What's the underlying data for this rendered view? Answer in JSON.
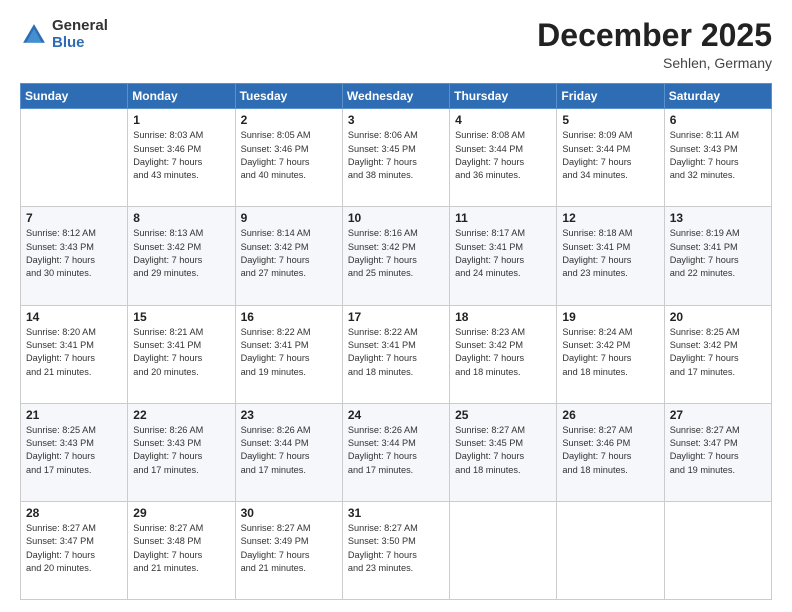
{
  "logo": {
    "general": "General",
    "blue": "Blue"
  },
  "header": {
    "month": "December 2025",
    "location": "Sehlen, Germany"
  },
  "days_of_week": [
    "Sunday",
    "Monday",
    "Tuesday",
    "Wednesday",
    "Thursday",
    "Friday",
    "Saturday"
  ],
  "weeks": [
    [
      {
        "day": "",
        "info": ""
      },
      {
        "day": "1",
        "info": "Sunrise: 8:03 AM\nSunset: 3:46 PM\nDaylight: 7 hours\nand 43 minutes."
      },
      {
        "day": "2",
        "info": "Sunrise: 8:05 AM\nSunset: 3:46 PM\nDaylight: 7 hours\nand 40 minutes."
      },
      {
        "day": "3",
        "info": "Sunrise: 8:06 AM\nSunset: 3:45 PM\nDaylight: 7 hours\nand 38 minutes."
      },
      {
        "day": "4",
        "info": "Sunrise: 8:08 AM\nSunset: 3:44 PM\nDaylight: 7 hours\nand 36 minutes."
      },
      {
        "day": "5",
        "info": "Sunrise: 8:09 AM\nSunset: 3:44 PM\nDaylight: 7 hours\nand 34 minutes."
      },
      {
        "day": "6",
        "info": "Sunrise: 8:11 AM\nSunset: 3:43 PM\nDaylight: 7 hours\nand 32 minutes."
      }
    ],
    [
      {
        "day": "7",
        "info": "Sunrise: 8:12 AM\nSunset: 3:43 PM\nDaylight: 7 hours\nand 30 minutes."
      },
      {
        "day": "8",
        "info": "Sunrise: 8:13 AM\nSunset: 3:42 PM\nDaylight: 7 hours\nand 29 minutes."
      },
      {
        "day": "9",
        "info": "Sunrise: 8:14 AM\nSunset: 3:42 PM\nDaylight: 7 hours\nand 27 minutes."
      },
      {
        "day": "10",
        "info": "Sunrise: 8:16 AM\nSunset: 3:42 PM\nDaylight: 7 hours\nand 25 minutes."
      },
      {
        "day": "11",
        "info": "Sunrise: 8:17 AM\nSunset: 3:41 PM\nDaylight: 7 hours\nand 24 minutes."
      },
      {
        "day": "12",
        "info": "Sunrise: 8:18 AM\nSunset: 3:41 PM\nDaylight: 7 hours\nand 23 minutes."
      },
      {
        "day": "13",
        "info": "Sunrise: 8:19 AM\nSunset: 3:41 PM\nDaylight: 7 hours\nand 22 minutes."
      }
    ],
    [
      {
        "day": "14",
        "info": "Sunrise: 8:20 AM\nSunset: 3:41 PM\nDaylight: 7 hours\nand 21 minutes."
      },
      {
        "day": "15",
        "info": "Sunrise: 8:21 AM\nSunset: 3:41 PM\nDaylight: 7 hours\nand 20 minutes."
      },
      {
        "day": "16",
        "info": "Sunrise: 8:22 AM\nSunset: 3:41 PM\nDaylight: 7 hours\nand 19 minutes."
      },
      {
        "day": "17",
        "info": "Sunrise: 8:22 AM\nSunset: 3:41 PM\nDaylight: 7 hours\nand 18 minutes."
      },
      {
        "day": "18",
        "info": "Sunrise: 8:23 AM\nSunset: 3:42 PM\nDaylight: 7 hours\nand 18 minutes."
      },
      {
        "day": "19",
        "info": "Sunrise: 8:24 AM\nSunset: 3:42 PM\nDaylight: 7 hours\nand 18 minutes."
      },
      {
        "day": "20",
        "info": "Sunrise: 8:25 AM\nSunset: 3:42 PM\nDaylight: 7 hours\nand 17 minutes."
      }
    ],
    [
      {
        "day": "21",
        "info": "Sunrise: 8:25 AM\nSunset: 3:43 PM\nDaylight: 7 hours\nand 17 minutes."
      },
      {
        "day": "22",
        "info": "Sunrise: 8:26 AM\nSunset: 3:43 PM\nDaylight: 7 hours\nand 17 minutes."
      },
      {
        "day": "23",
        "info": "Sunrise: 8:26 AM\nSunset: 3:44 PM\nDaylight: 7 hours\nand 17 minutes."
      },
      {
        "day": "24",
        "info": "Sunrise: 8:26 AM\nSunset: 3:44 PM\nDaylight: 7 hours\nand 17 minutes."
      },
      {
        "day": "25",
        "info": "Sunrise: 8:27 AM\nSunset: 3:45 PM\nDaylight: 7 hours\nand 18 minutes."
      },
      {
        "day": "26",
        "info": "Sunrise: 8:27 AM\nSunset: 3:46 PM\nDaylight: 7 hours\nand 18 minutes."
      },
      {
        "day": "27",
        "info": "Sunrise: 8:27 AM\nSunset: 3:47 PM\nDaylight: 7 hours\nand 19 minutes."
      }
    ],
    [
      {
        "day": "28",
        "info": "Sunrise: 8:27 AM\nSunset: 3:47 PM\nDaylight: 7 hours\nand 20 minutes."
      },
      {
        "day": "29",
        "info": "Sunrise: 8:27 AM\nSunset: 3:48 PM\nDaylight: 7 hours\nand 21 minutes."
      },
      {
        "day": "30",
        "info": "Sunrise: 8:27 AM\nSunset: 3:49 PM\nDaylight: 7 hours\nand 21 minutes."
      },
      {
        "day": "31",
        "info": "Sunrise: 8:27 AM\nSunset: 3:50 PM\nDaylight: 7 hours\nand 23 minutes."
      },
      {
        "day": "",
        "info": ""
      },
      {
        "day": "",
        "info": ""
      },
      {
        "day": "",
        "info": ""
      }
    ]
  ]
}
